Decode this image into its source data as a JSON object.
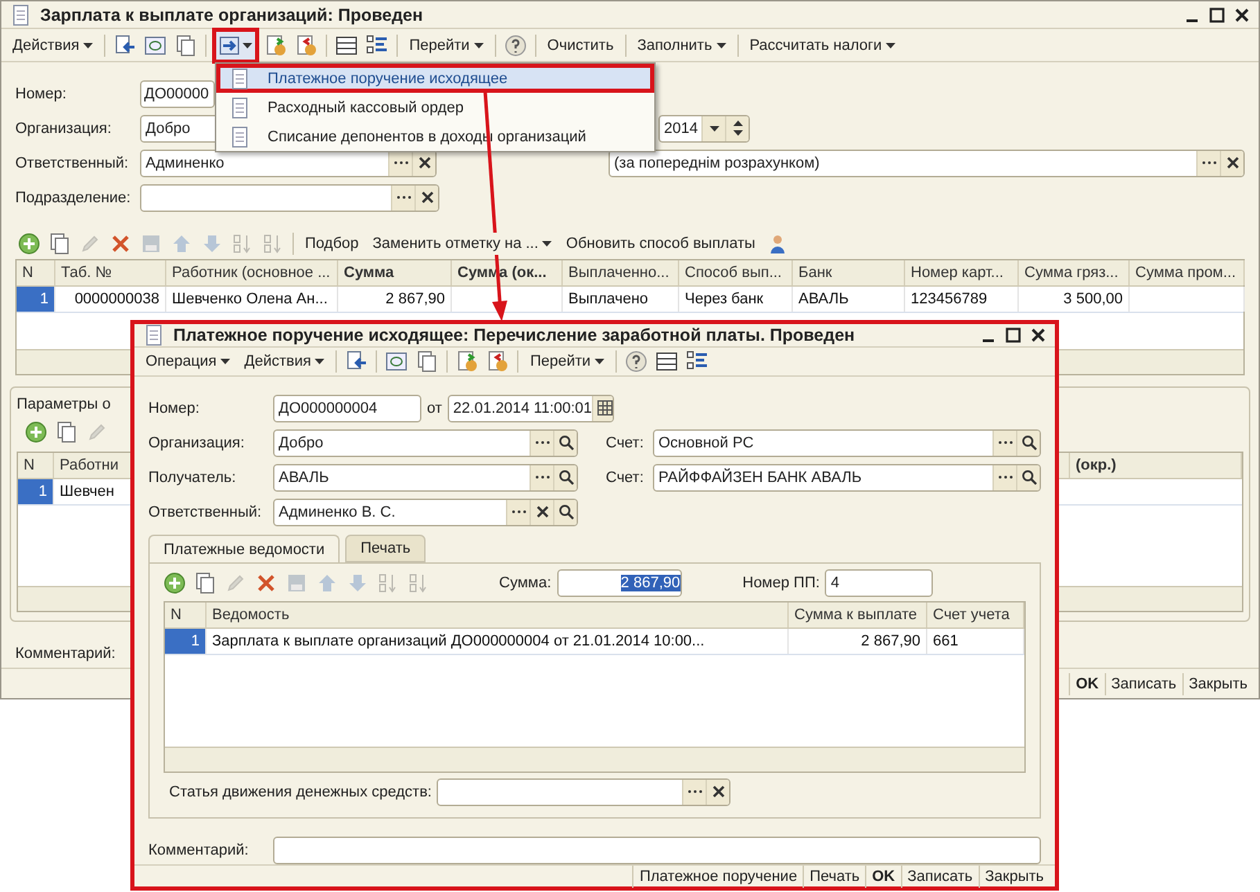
{
  "main_window": {
    "title": "Зарплата к выплате организаций: Проведен",
    "toolbar": [
      {
        "kind": "menu",
        "label": "Действия"
      },
      {
        "kind": "separator"
      },
      {
        "kind": "icon"
      },
      {
        "kind": "icon"
      },
      {
        "kind": "icon"
      },
      {
        "kind": "separator"
      },
      {
        "kind": "icon-menu",
        "highlighted": true
      },
      {
        "kind": "icon"
      },
      {
        "kind": "icon"
      },
      {
        "kind": "separator"
      },
      {
        "kind": "icon"
      },
      {
        "kind": "icon"
      },
      {
        "kind": "separator"
      },
      {
        "kind": "menu",
        "label": "Перейти"
      },
      {
        "kind": "separator"
      },
      {
        "kind": "icon"
      },
      {
        "kind": "separator"
      },
      {
        "kind": "button",
        "label": "Очистить"
      },
      {
        "kind": "separator"
      },
      {
        "kind": "menu",
        "label": "Заполнить"
      },
      {
        "kind": "separator"
      },
      {
        "kind": "menu",
        "label": "Рассчитать налоги"
      }
    ],
    "number": {
      "label": "Номер:",
      "value": "ДО00000"
    },
    "organization": {
      "label": "Организация:",
      "value": "Добро"
    },
    "date": {
      "value": "2014"
    },
    "responsible": {
      "label": "Ответственный:",
      "value": "Админенко"
    },
    "payment_kind": {
      "value": "(за попереднім розрахунком)"
    },
    "department": {
      "label": "Подразделение:"
    },
    "table_toolbar": [
      {
        "kind": "icon",
        "disabled": false
      },
      {
        "kind": "icon",
        "disabled": false
      },
      {
        "kind": "icon",
        "disabled": true
      },
      {
        "kind": "icon",
        "disabled": false
      },
      {
        "kind": "icon",
        "disabled": true
      },
      {
        "kind": "icon",
        "disabled": true
      },
      {
        "kind": "icon",
        "disabled": true
      },
      {
        "kind": "icon",
        "disabled": true
      },
      {
        "kind": "icon",
        "disabled": true
      },
      {
        "kind": "separator"
      },
      {
        "kind": "button",
        "label": "Подбор"
      },
      {
        "kind": "menu",
        "label": "Заменить отметку на ..."
      },
      {
        "kind": "button",
        "label": "Обновить способ выплаты"
      },
      {
        "kind": "icon",
        "disabled": false
      }
    ],
    "table": {
      "columns": [
        {
          "label": "N",
          "emphasized": false
        },
        {
          "label": "Таб. №",
          "emphasized": false
        },
        {
          "label": "Работник (основное ...",
          "emphasized": false
        },
        {
          "label": "Сумма",
          "emphasized": true
        },
        {
          "label": "Сумма (ок...",
          "emphasized": true
        },
        {
          "label": "Выплаченно...",
          "emphasized": false
        },
        {
          "label": "Способ вып...",
          "emphasized": false
        },
        {
          "label": "Банк",
          "emphasized": false
        },
        {
          "label": "Номер карт...",
          "emphasized": false
        },
        {
          "label": "Сумма гряз...",
          "emphasized": false
        },
        {
          "label": "Сумма пром...",
          "emphasized": false
        }
      ],
      "rows": [
        {
          "selected": true,
          "cells": [
            "1",
            "0000000038",
            "Шевченко Олена Ан...",
            "2 867,90",
            "",
            "Выплачено",
            "Через банк",
            "АВАЛЬ",
            "123456789",
            "3 500,00",
            ""
          ]
        }
      ]
    },
    "params": {
      "tab": "Параметры о",
      "toolbar": [
        {
          "kind": "icon",
          "disabled": false
        },
        {
          "kind": "icon",
          "disabled": false
        },
        {
          "kind": "icon",
          "disabled": true
        }
      ],
      "columns": [
        {
          "label": "N",
          "emphasized": false
        },
        {
          "label": "Работни",
          "emphasized": false
        },
        {
          "label": "(окр.)",
          "emphasized": true
        }
      ],
      "rows": [
        {
          "selected": true,
          "cells": [
            "1",
            "Шевчен"
          ]
        }
      ]
    },
    "comment": {
      "label": "Комментарий:"
    },
    "buttons": [
      {
        "label": "OK",
        "default": true
      },
      {
        "label": "Записать",
        "default": false
      },
      {
        "label": "Закрыть",
        "default": false
      }
    ]
  },
  "dropdown_menu": [
    {
      "label": "Платежное поручение исходящее",
      "selected": true
    },
    {
      "label": "Расходный кассовый ордер",
      "selected": false
    },
    {
      "label": "Списание депонентов в доходы организаций",
      "selected": false
    }
  ],
  "payment_window": {
    "title": "Платежное поручение исходящее: Перечисление заработной платы. Проведен",
    "toolbar": [
      {
        "kind": "menu",
        "label": "Операция"
      },
      {
        "kind": "menu",
        "label": "Действия"
      },
      {
        "kind": "separator"
      },
      {
        "kind": "icon"
      },
      {
        "kind": "separator"
      },
      {
        "kind": "icon"
      },
      {
        "kind": "icon"
      },
      {
        "kind": "separator"
      },
      {
        "kind": "icon"
      },
      {
        "kind": "icon"
      },
      {
        "kind": "separator"
      },
      {
        "kind": "menu",
        "label": "Перейти"
      },
      {
        "kind": "separator"
      },
      {
        "kind": "icon"
      },
      {
        "kind": "icon"
      },
      {
        "kind": "icon"
      }
    ],
    "number": {
      "label": "Номер:",
      "value": "ДО000000004"
    },
    "date": {
      "label": "от",
      "value": "22.01.2014 11:00:01"
    },
    "organization": {
      "label": "Организация:",
      "value": "Добро"
    },
    "account": {
      "label": "Счет:",
      "value": "Основной РС"
    },
    "recipient": {
      "label": "Получатель:",
      "value": "АВАЛЬ"
    },
    "recipient_account": {
      "label": "Счет:",
      "value": "РАЙФФАЙЗЕН БАНК АВАЛЬ"
    },
    "responsible": {
      "label": "Ответственный:",
      "value": "Админенко В. С."
    },
    "tabs": [
      {
        "label": "Платежные ведомости",
        "selected": true
      },
      {
        "label": "Печать",
        "selected": false
      }
    ],
    "table_toolbar": [
      {
        "kind": "icon",
        "disabled": false
      },
      {
        "kind": "icon",
        "disabled": false
      },
      {
        "kind": "icon",
        "disabled": true
      },
      {
        "kind": "icon",
        "disabled": false
      },
      {
        "kind": "icon",
        "disabled": true
      },
      {
        "kind": "icon",
        "disabled": true
      },
      {
        "kind": "icon",
        "disabled": true
      },
      {
        "kind": "icon",
        "disabled": true
      },
      {
        "kind": "icon",
        "disabled": true
      }
    ],
    "sum": {
      "label": "Сумма:",
      "value": "2 867,90",
      "highlighted": true
    },
    "order_number": {
      "label": "Номер ПП:",
      "value": "4"
    },
    "table": {
      "columns": [
        {
          "label": "N",
          "emphasized": false
        },
        {
          "label": "Ведомость",
          "emphasized": false
        },
        {
          "label": "Сумма к выплате",
          "emphasized": false
        },
        {
          "label": "Счет учета",
          "emphasized": false
        }
      ],
      "rows": [
        {
          "selected": true,
          "cells": [
            "1",
            "Зарплата к выплате организаций ДО000000004 от 21.01.2014 10:00...",
            "2 867,90",
            "661"
          ]
        }
      ]
    },
    "cash_flow_item": {
      "label": "Статья движения денежных средств:"
    },
    "comment": {
      "label": "Комментарий:"
    },
    "buttons": [
      {
        "label": "Платежное поручение",
        "default": false
      },
      {
        "label": "Печать",
        "default": false
      },
      {
        "label": "OK",
        "default": true
      },
      {
        "label": "Записать",
        "default": false
      },
      {
        "label": "Закрыть",
        "default": false
      }
    ]
  }
}
